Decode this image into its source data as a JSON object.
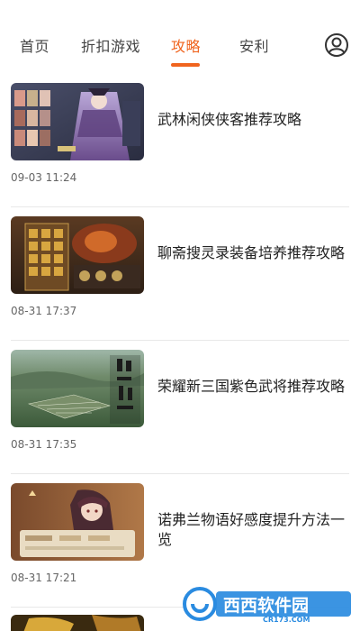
{
  "nav": {
    "tabs": [
      {
        "label": "首页"
      },
      {
        "label": "折扣游戏"
      },
      {
        "label": "攻略"
      },
      {
        "label": "安利"
      }
    ],
    "active_tab": "攻略",
    "user_icon": "user-circle-icon",
    "accent_color": "#f0641e"
  },
  "articles": [
    {
      "title": "武林闲侠侠客推荐攻略",
      "time": "09-03 11:24",
      "thumb_icon": "game-art-characters"
    },
    {
      "title": "聊斋搜灵录装备培养推荐攻略",
      "time": "08-31 17:37",
      "thumb_icon": "game-art-board"
    },
    {
      "title": "荣耀新三国紫色武将推荐攻略",
      "time": "08-31 17:35",
      "thumb_icon": "game-art-landscape"
    },
    {
      "title": "诺弗兰物语好感度提升方法一览",
      "time": "08-31 17:21",
      "thumb_icon": "game-art-anime-girl"
    }
  ],
  "watermark": {
    "brand": "西西软件园",
    "url": "CR173.COM",
    "logo_color": "#2a8be0"
  }
}
